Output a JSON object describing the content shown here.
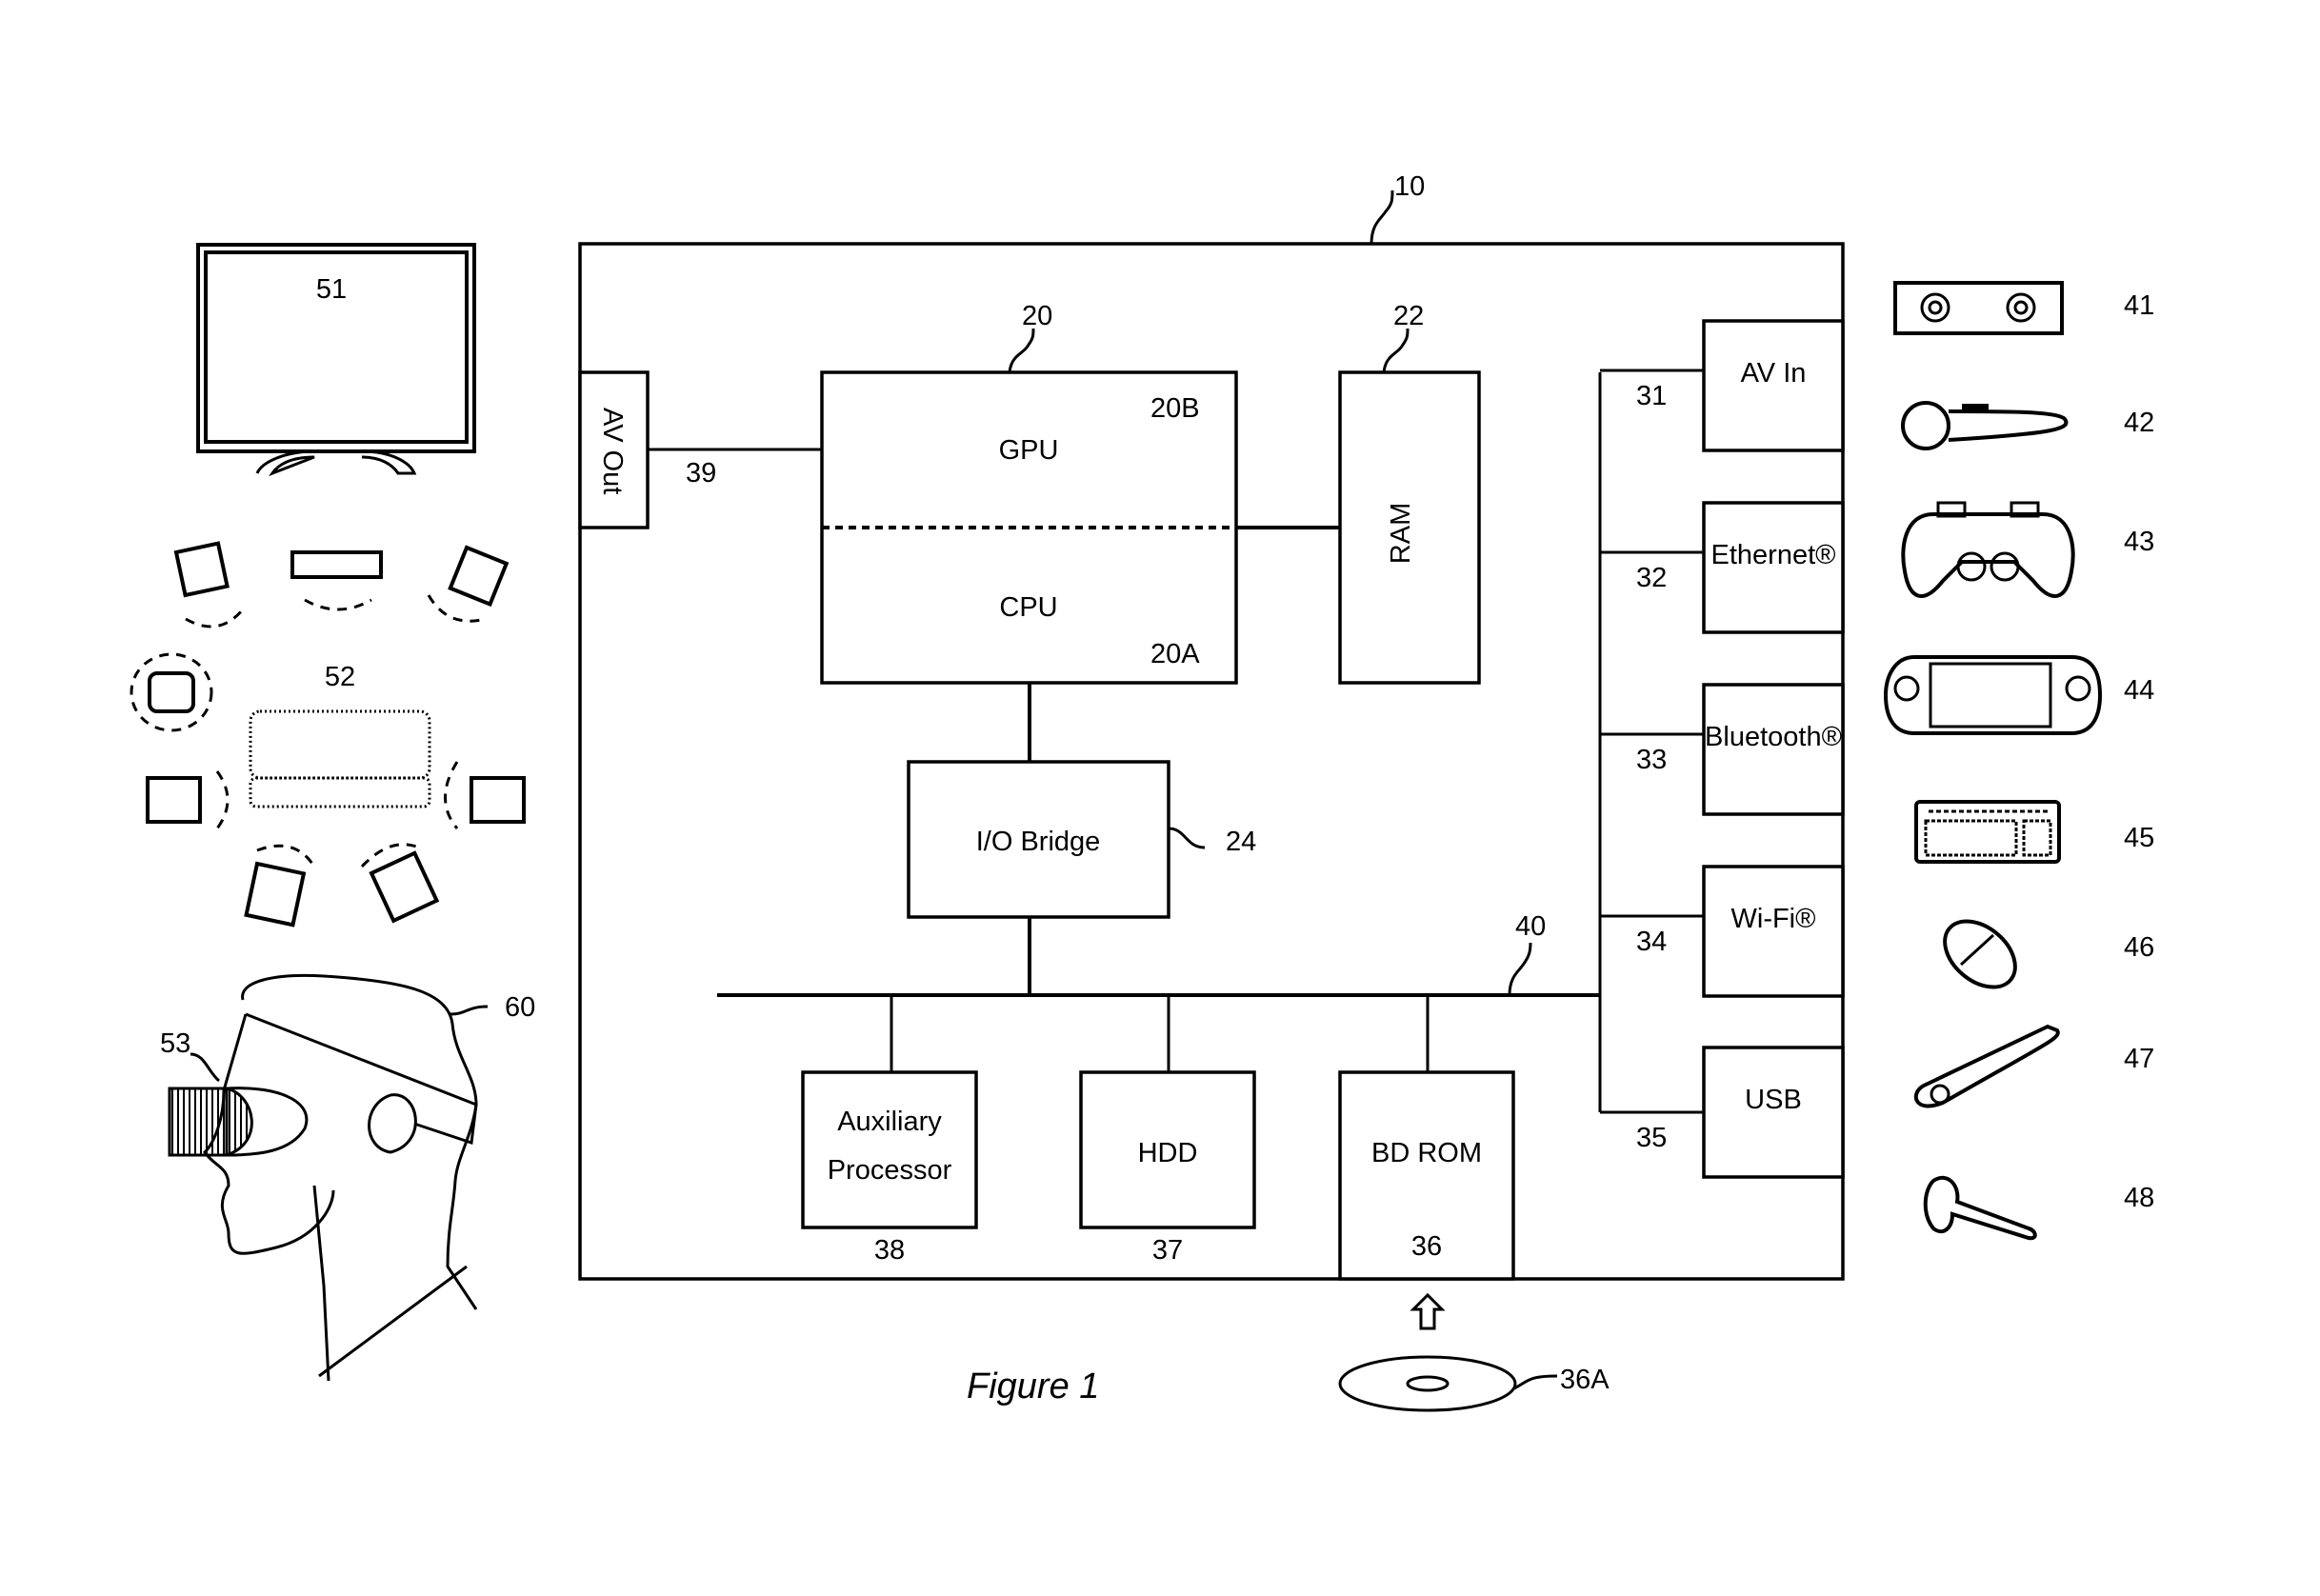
{
  "figure": {
    "caption": "Figure 1",
    "system_ref": "10",
    "blocks": {
      "av_out": {
        "label": "AV Out",
        "ref": "39"
      },
      "gpu": {
        "label": "GPU",
        "ref": "20B"
      },
      "cpu": {
        "label": "CPU",
        "ref": "20A"
      },
      "processor_ref": "20",
      "ram": {
        "label": "RAM",
        "ref": "22"
      },
      "io_bridge": {
        "label": "I/O Bridge",
        "ref": "24"
      },
      "bus_ref": "40",
      "aux": {
        "label_line1": "Auxiliary",
        "label_line2": "Processor",
        "ref": "38"
      },
      "hdd": {
        "label": "HDD",
        "ref": "37"
      },
      "bd_rom": {
        "label": "BD ROM",
        "ref": "36"
      },
      "disc_ref": "36A"
    },
    "ports": [
      {
        "label": "AV In",
        "ref": "31"
      },
      {
        "label": "Ethernet®",
        "ref": "32"
      },
      {
        "label": "Bluetooth®",
        "ref": "33"
      },
      {
        "label": "Wi-Fi®",
        "ref": "34"
      },
      {
        "label": "USB",
        "ref": "35"
      }
    ],
    "peripherals": [
      {
        "name": "camera",
        "ref": "41"
      },
      {
        "name": "motion-controller",
        "ref": "42"
      },
      {
        "name": "gamepad",
        "ref": "43"
      },
      {
        "name": "portable-console",
        "ref": "44"
      },
      {
        "name": "keyboard",
        "ref": "45"
      },
      {
        "name": "mouse",
        "ref": "46"
      },
      {
        "name": "remote-control",
        "ref": "47"
      },
      {
        "name": "headset",
        "ref": "48"
      }
    ],
    "left": {
      "display_ref": "51",
      "surround_ref": "52",
      "hmd_ref": "53",
      "user_ref": "60"
    }
  }
}
